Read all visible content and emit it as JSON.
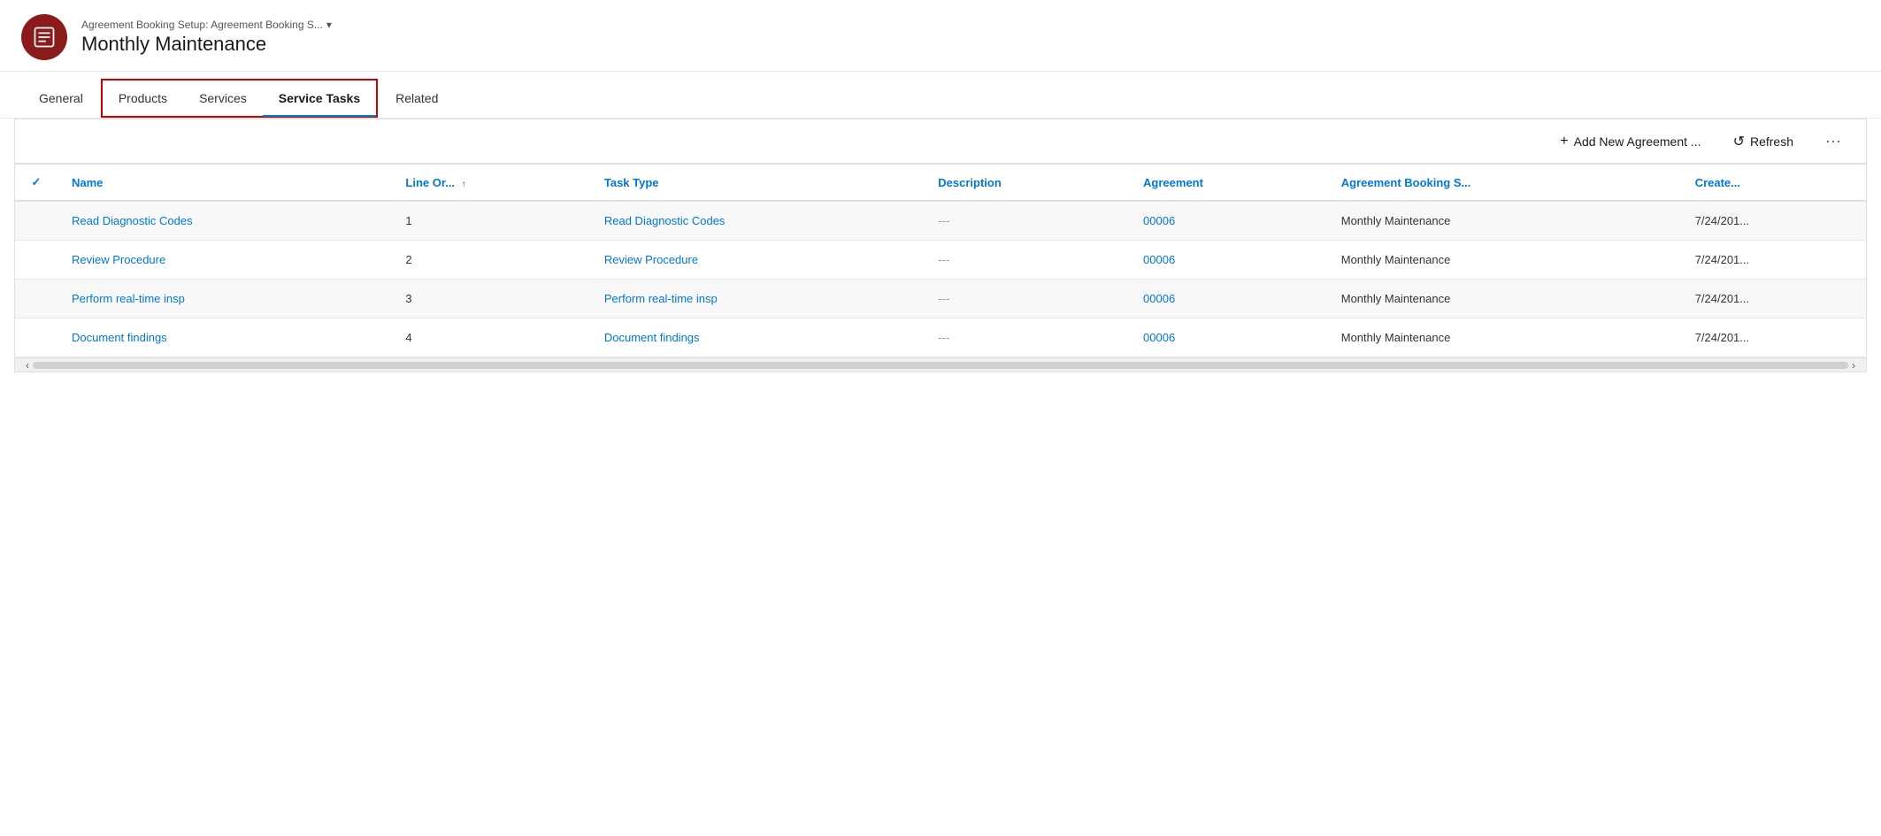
{
  "header": {
    "breadcrumb": "Agreement Booking Setup: Agreement Booking S...",
    "chevron": "▾",
    "title": "Monthly Maintenance",
    "icon_label": "agreement-booking-icon"
  },
  "tabs": {
    "items": [
      {
        "id": "general",
        "label": "General",
        "active": false,
        "in_border_group": false
      },
      {
        "id": "products",
        "label": "Products",
        "active": false,
        "in_border_group": true
      },
      {
        "id": "services",
        "label": "Services",
        "active": false,
        "in_border_group": true
      },
      {
        "id": "service-tasks",
        "label": "Service Tasks",
        "active": true,
        "in_border_group": true
      },
      {
        "id": "related",
        "label": "Related",
        "active": false,
        "in_border_group": false
      }
    ]
  },
  "toolbar": {
    "add_label": "Add New Agreement ...",
    "add_icon": "+",
    "refresh_label": "Refresh",
    "refresh_icon": "↺",
    "more_icon": "···"
  },
  "table": {
    "columns": [
      {
        "id": "check",
        "label": "✓",
        "sortable": false
      },
      {
        "id": "name",
        "label": "Name",
        "sortable": false
      },
      {
        "id": "line_order",
        "label": "Line Or...",
        "sortable": true
      },
      {
        "id": "task_type",
        "label": "Task Type",
        "sortable": false
      },
      {
        "id": "description",
        "label": "Description",
        "sortable": false
      },
      {
        "id": "agreement",
        "label": "Agreement",
        "sortable": false
      },
      {
        "id": "agreement_booking",
        "label": "Agreement Booking S...",
        "sortable": false
      },
      {
        "id": "created",
        "label": "Create...",
        "sortable": false
      }
    ],
    "rows": [
      {
        "name": "Read Diagnostic Codes",
        "line_order": "1",
        "task_type": "Read Diagnostic Codes",
        "description": "---",
        "agreement": "00006",
        "agreement_booking": "Monthly Maintenance",
        "created": "7/24/201..."
      },
      {
        "name": "Review Procedure",
        "line_order": "2",
        "task_type": "Review Procedure",
        "description": "---",
        "agreement": "00006",
        "agreement_booking": "Monthly Maintenance",
        "created": "7/24/201..."
      },
      {
        "name": "Perform real-time insp",
        "line_order": "3",
        "task_type": "Perform real-time insp",
        "description": "---",
        "agreement": "00006",
        "agreement_booking": "Monthly Maintenance",
        "created": "7/24/201..."
      },
      {
        "name": "Document findings",
        "line_order": "4",
        "task_type": "Document findings",
        "description": "---",
        "agreement": "00006",
        "agreement_booking": "Monthly Maintenance",
        "created": "7/24/201..."
      }
    ]
  },
  "colors": {
    "accent": "#0078d4",
    "icon_bg": "#8B1A1A",
    "border_red": "#cc0000",
    "active_tab_underline": "#0078d4"
  }
}
